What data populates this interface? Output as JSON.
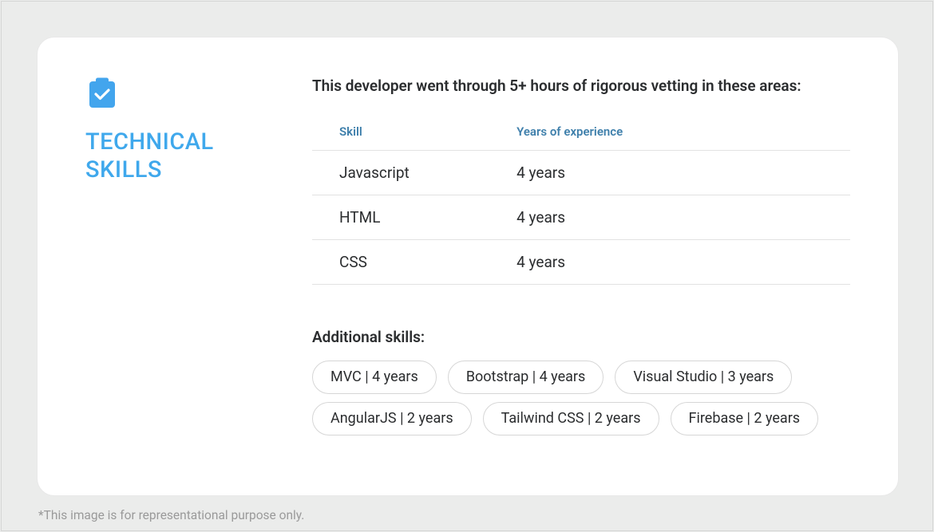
{
  "section_title": "TECHNICAL SKILLS",
  "intro": "This developer went through 5+ hours of rigorous vetting in these areas:",
  "table": {
    "header_skill": "Skill",
    "header_years": "Years of experience",
    "rows": [
      {
        "skill": "Javascript",
        "years": "4 years"
      },
      {
        "skill": "HTML",
        "years": "4 years"
      },
      {
        "skill": "CSS",
        "years": "4 years"
      }
    ]
  },
  "additional_title": "Additional skills:",
  "chips": [
    "MVC | 4 years",
    "Bootstrap | 4 years",
    "Visual Studio | 3 years",
    "AngularJS | 2 years",
    "Tailwind CSS | 2 years",
    "Firebase | 2 years"
  ],
  "disclaimer": "*This image is for representational purpose only."
}
